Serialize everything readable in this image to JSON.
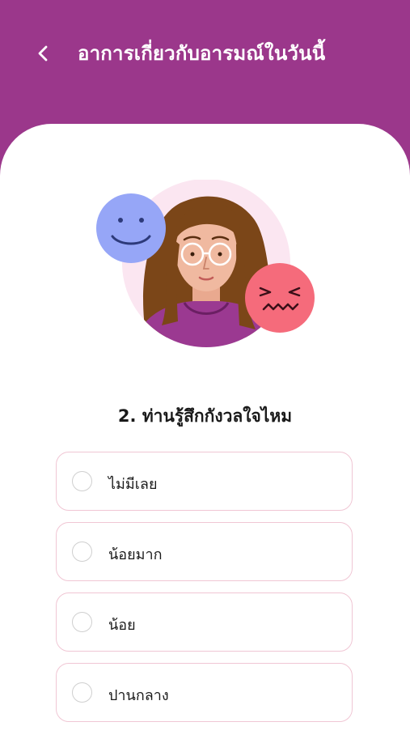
{
  "header": {
    "back_icon": "chevron-left-icon",
    "title": "อาการเกี่ยวกับอารมณ์ในวันนี้"
  },
  "illustration": {
    "description_icons": [
      "happy-face-icon",
      "stressed-face-icon",
      "woman-avatar"
    ]
  },
  "question": {
    "text": "2. ท่านรู้สึกกังวลใจไหม"
  },
  "options": [
    {
      "label": "ไม่มีเลย",
      "selected": false
    },
    {
      "label": "น้อยมาก",
      "selected": false
    },
    {
      "label": "น้อย",
      "selected": false
    },
    {
      "label": "ปานกลาง",
      "selected": false
    }
  ],
  "colors": {
    "brand": "#9b378b",
    "option_border": "#f0c6d4",
    "happy_face": "#96a6f7",
    "stressed_face": "#f56b7b",
    "shirt": "#9b3991"
  }
}
